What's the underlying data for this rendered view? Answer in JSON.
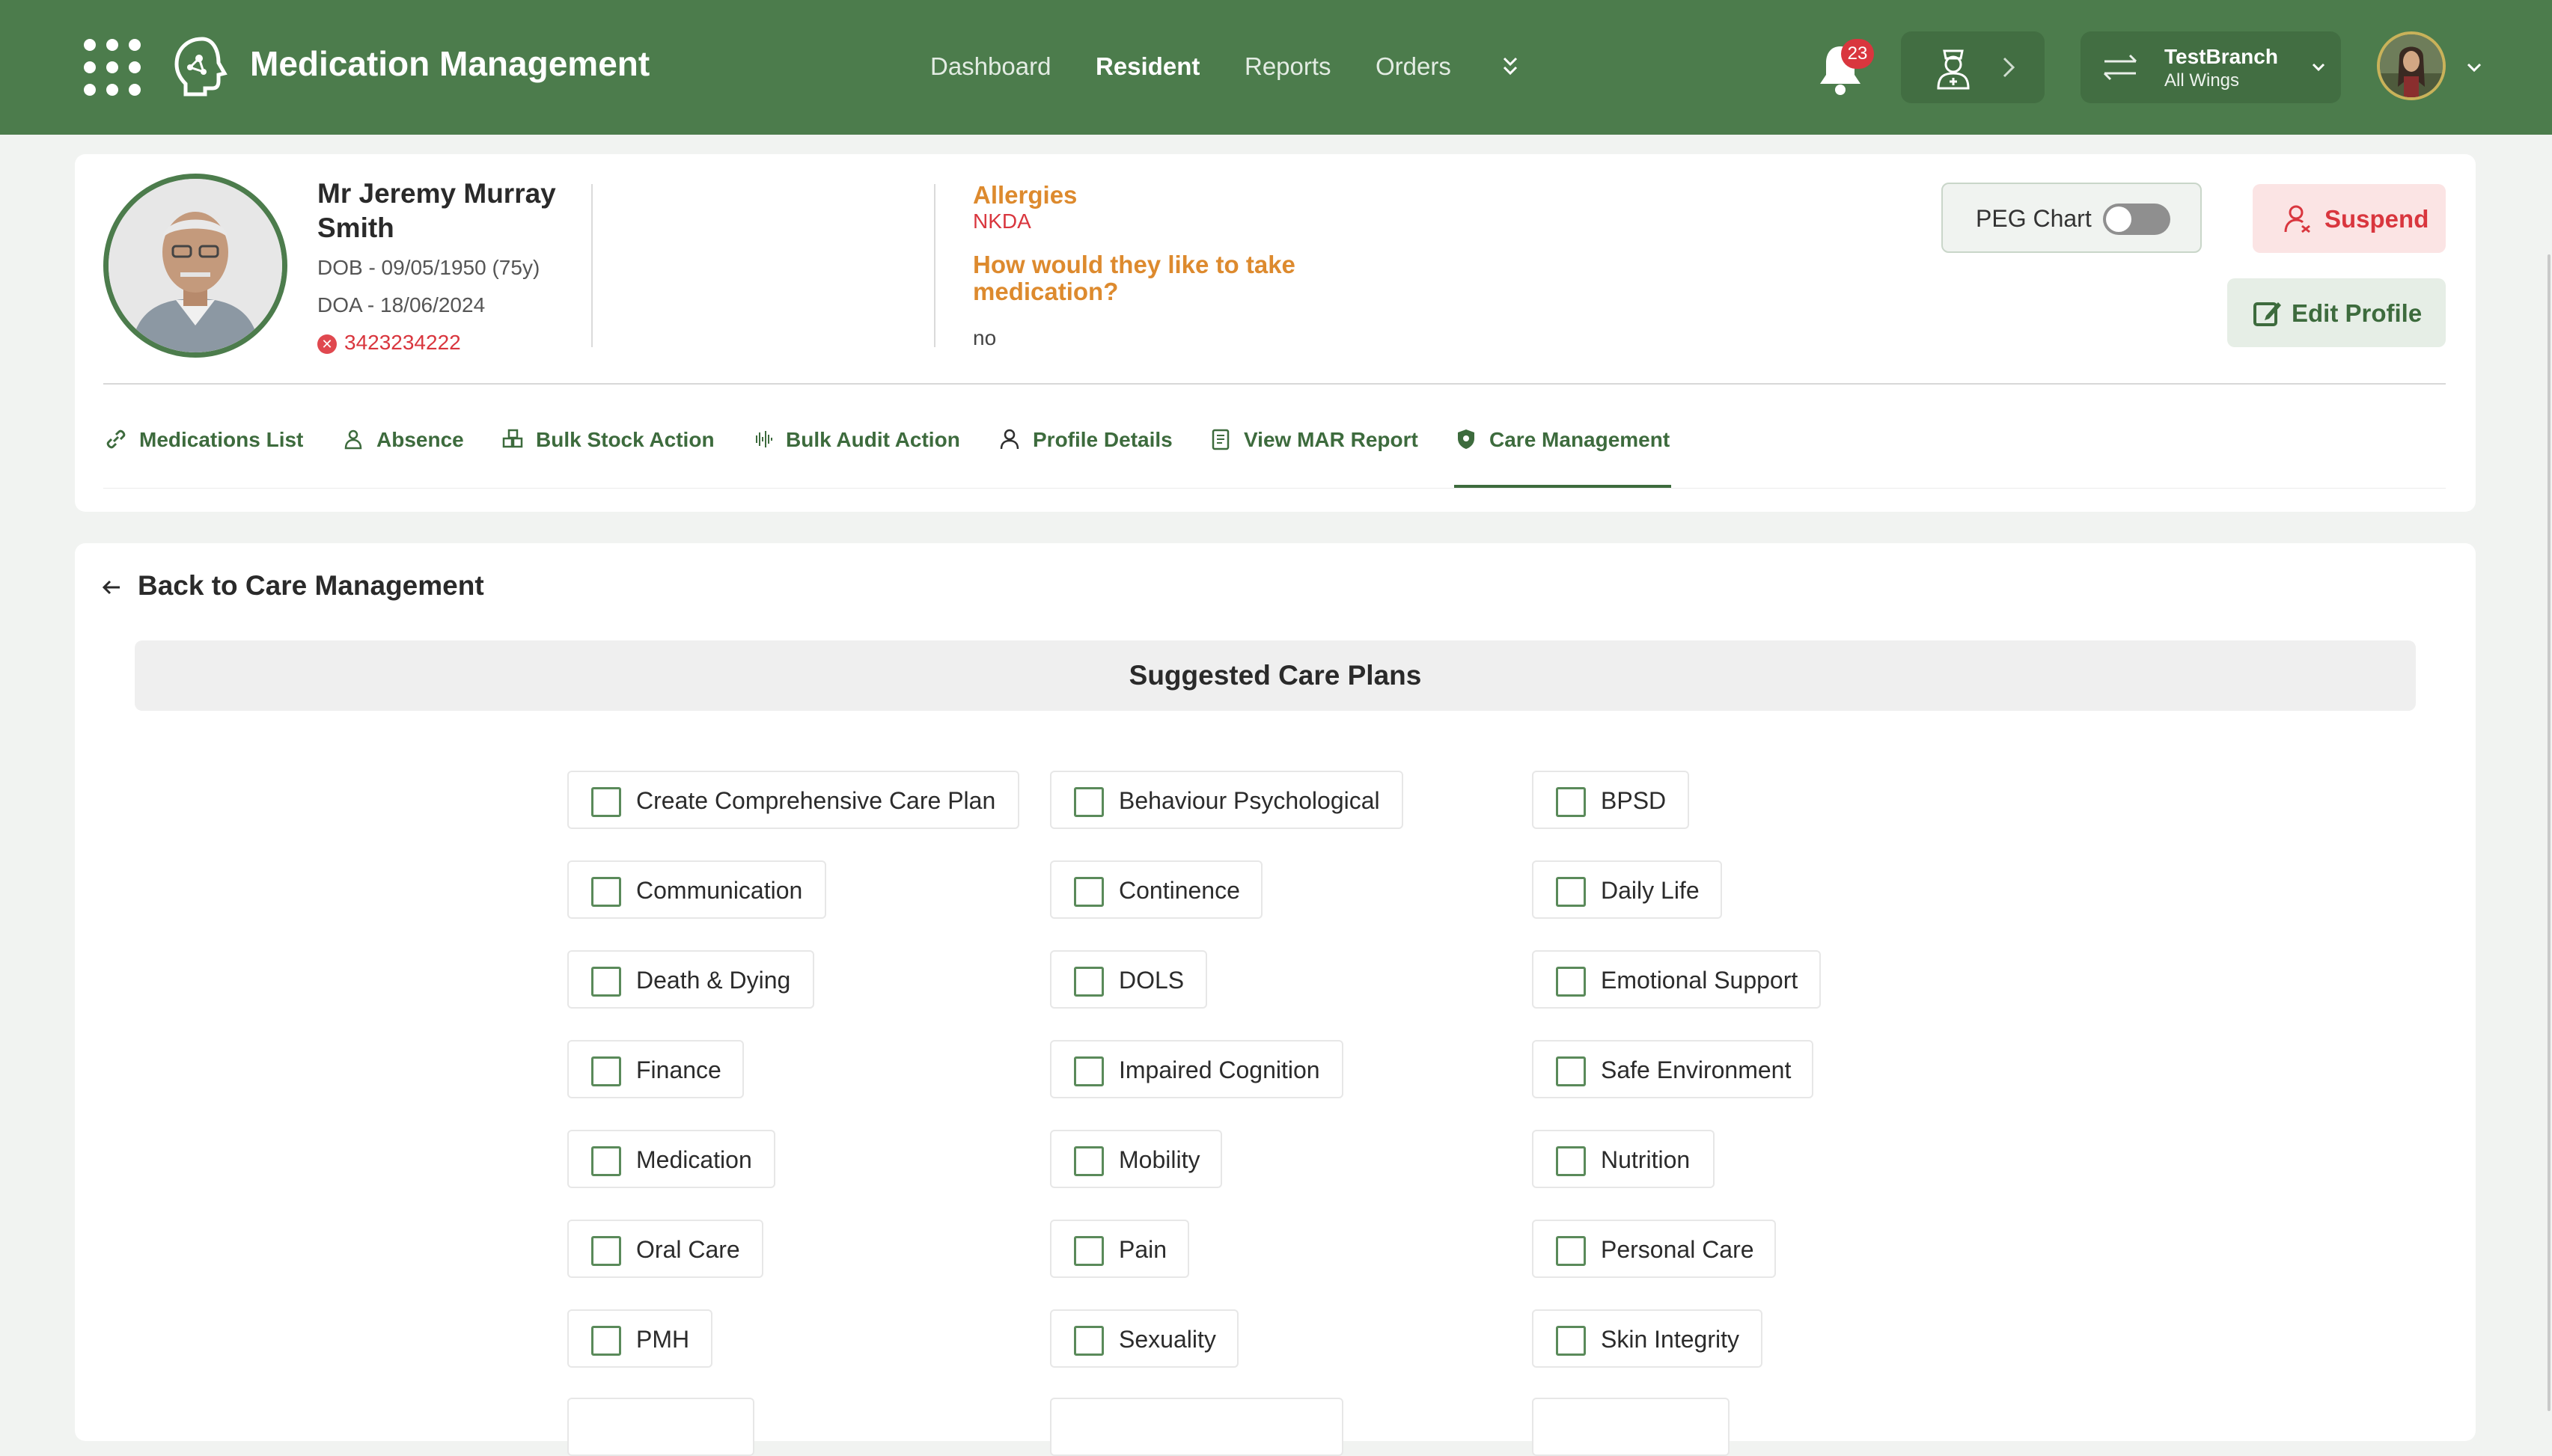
{
  "app": {
    "title": "Medication Management"
  },
  "nav": {
    "items": [
      "Dashboard",
      "Resident",
      "Reports",
      "Orders"
    ],
    "active": "Resident"
  },
  "notifications": {
    "count": "23"
  },
  "branch": {
    "name": "TestBranch",
    "sub": "All Wings"
  },
  "resident": {
    "name": "Mr Jeremy Murray Smith",
    "dob": "DOB - 09/05/1950 (75y)",
    "doa": "DOA - 18/06/2024",
    "phone": "3423234222"
  },
  "allergies": {
    "title": "Allergies",
    "value": "NKDA",
    "take_question": "How would they like to take medication?",
    "take_answer": "no"
  },
  "actions": {
    "peg_chart": "PEG Chart",
    "peg_on": false,
    "suspend": "Suspend",
    "edit_profile": "Edit Profile"
  },
  "tabs": [
    {
      "label": "Medications List",
      "icon": "link-icon"
    },
    {
      "label": "Absence",
      "icon": "person-absence-icon"
    },
    {
      "label": "Bulk Stock Action",
      "icon": "stock-icon"
    },
    {
      "label": "Bulk Audit Action",
      "icon": "audit-wave-icon"
    },
    {
      "label": "Profile Details",
      "icon": "user-icon"
    },
    {
      "label": "View MAR Report",
      "icon": "report-icon"
    },
    {
      "label": "Care Management",
      "icon": "shield-icon"
    }
  ],
  "active_tab": "Care Management",
  "care": {
    "back_label": "Back to Care Management",
    "suggested_title": "Suggested Care Plans",
    "options": [
      "Create Comprehensive Care Plan",
      "Behaviour Psychological",
      "BPSD",
      "Communication",
      "Continence",
      "Daily Life",
      "Death & Dying",
      "DOLS",
      "Emotional Support",
      "Finance",
      "Impaired Cognition",
      "Safe Environment",
      "Medication",
      "Mobility",
      "Nutrition",
      "Oral Care",
      "Pain",
      "Personal Care",
      "PMH",
      "Sexuality",
      "Skin Integrity"
    ]
  },
  "colors": {
    "brand": "#4c7c4c",
    "accent_orange": "#dd8a2e",
    "danger": "#d9363e"
  }
}
